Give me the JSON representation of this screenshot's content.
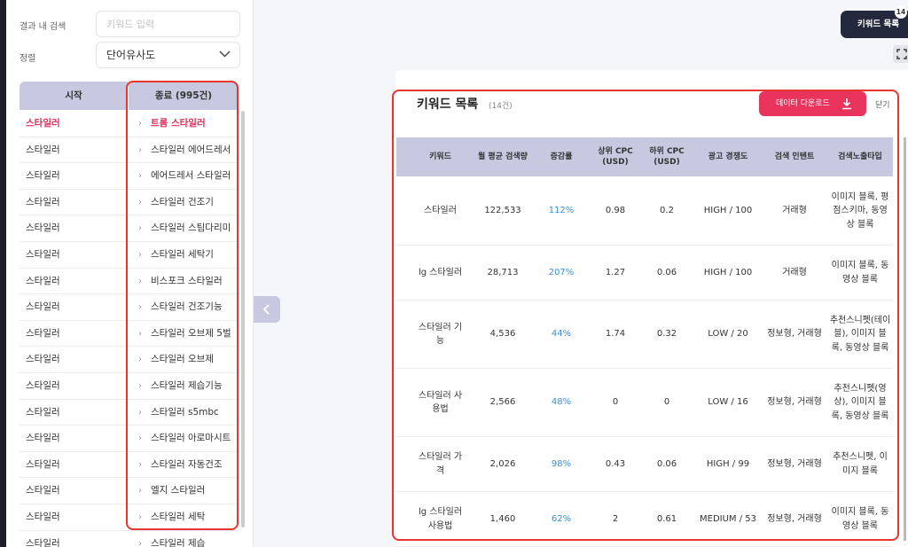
{
  "filters": {
    "search_label": "결과 내 검색",
    "search_placeholder": "키워드 입력",
    "sort_label": "정렬",
    "sort_value": "단어유사도"
  },
  "list": {
    "col_start": "시작",
    "col_end": "종료 (995건)",
    "rows": [
      {
        "start": "스타일러",
        "end": "트롬 스타일러",
        "active": true
      },
      {
        "start": "스타일러",
        "end": "스타일러 에어드레서"
      },
      {
        "start": "스타일러",
        "end": "에어드레서 스타일러"
      },
      {
        "start": "스타일러",
        "end": "스타일러 건조기"
      },
      {
        "start": "스타일러",
        "end": "스타일러 스팀다리미"
      },
      {
        "start": "스타일러",
        "end": "스타일러 세탁기"
      },
      {
        "start": "스타일러",
        "end": "비스포크 스타일러"
      },
      {
        "start": "스타일러",
        "end": "스타일러 건조기능"
      },
      {
        "start": "스타일러",
        "end": "스타일러 오브제 5벌"
      },
      {
        "start": "스타일러",
        "end": "스타일러 오브제"
      },
      {
        "start": "스타일러",
        "end": "스타일러 제습기능"
      },
      {
        "start": "스타일러",
        "end": "스타일러 s5mbc"
      },
      {
        "start": "스타일러",
        "end": "스타일러 아로마시트"
      },
      {
        "start": "스타일러",
        "end": "스타일러 자동건조"
      },
      {
        "start": "스타일러",
        "end": "엘지 스타일러"
      },
      {
        "start": "스타일러",
        "end": "스타일러 세탁"
      },
      {
        "start": "스타일러",
        "end": "스타일러 제습"
      }
    ]
  },
  "toolbar": {
    "keyword_list_button": "키워드 목록",
    "badge_count": "14"
  },
  "modal": {
    "title": "키워드 목록",
    "count": "(14건)",
    "download_label": "데이터 다운로드",
    "close_label": "닫기"
  },
  "table": {
    "headers": {
      "keyword": "키워드",
      "volume": "월 평균 검색량",
      "rate": "증감률",
      "cpc_high": "상위 CPC (USD)",
      "cpc_low": "하위 CPC (USD)",
      "competition": "광고 경쟁도",
      "intent": "검색 인텐트",
      "exposure": "검색노출타입"
    },
    "rows": [
      {
        "keyword": "스타일러",
        "volume": "122,533",
        "rate": "112%",
        "cpc_high": "0.98",
        "cpc_low": "0.2",
        "competition": "HIGH / 100",
        "intent": "거래형",
        "exposure": "이미지 블록, 평점스키마, 동영상 블록"
      },
      {
        "keyword": "lg 스타일러",
        "volume": "28,713",
        "rate": "207%",
        "cpc_high": "1.27",
        "cpc_low": "0.06",
        "competition": "HIGH / 100",
        "intent": "거래형",
        "exposure": "이미지 블록, 동영상 블록"
      },
      {
        "keyword": "스타일러 기능",
        "volume": "4,536",
        "rate": "44%",
        "cpc_high": "1.74",
        "cpc_low": "0.32",
        "competition": "LOW / 20",
        "intent": "정보형, 거래형",
        "exposure": "추천스니펫(테이블), 이미지 블록, 동영상 블록"
      },
      {
        "keyword": "스타일러 사용법",
        "volume": "2,566",
        "rate": "48%",
        "cpc_high": "0",
        "cpc_low": "0",
        "competition": "LOW / 16",
        "intent": "정보형, 거래형",
        "exposure": "추천스니펫(영상), 이미지 블록, 동영상 블록"
      },
      {
        "keyword": "스타일러 가격",
        "volume": "2,026",
        "rate": "98%",
        "cpc_high": "0.43",
        "cpc_low": "0.06",
        "competition": "HIGH / 99",
        "intent": "정보형, 거래형",
        "exposure": "추천스니펫, 이미지 블록"
      },
      {
        "keyword": "lg 스타일러 사용법",
        "volume": "1,460",
        "rate": "62%",
        "cpc_high": "2",
        "cpc_low": "0.61",
        "competition": "MEDIUM / 53",
        "intent": "정보형, 거래형",
        "exposure": "이미지 블록, 동영상 블록"
      }
    ]
  },
  "colors": {
    "accent": "#e8335c",
    "header_bg": "#c8c8e0",
    "rate_text": "#3a8fd9",
    "highlight_box": "#e8352e",
    "dark_button": "#24283c"
  }
}
